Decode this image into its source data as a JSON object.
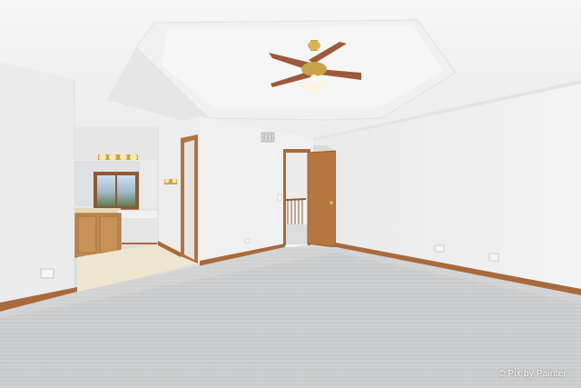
{
  "photo": {
    "watermark": "© Pix by Painter",
    "colors": {
      "ceiling": "#f3f3f3",
      "wall": "#efefef",
      "carpet": "#cdcecf",
      "trim_wood": "#a86a3c",
      "door_wood": "#b5773f",
      "cabinet_wood": "#c28a4e",
      "tile_floor": "#efe6d2",
      "fan_blade": "#9c5a3a"
    }
  }
}
